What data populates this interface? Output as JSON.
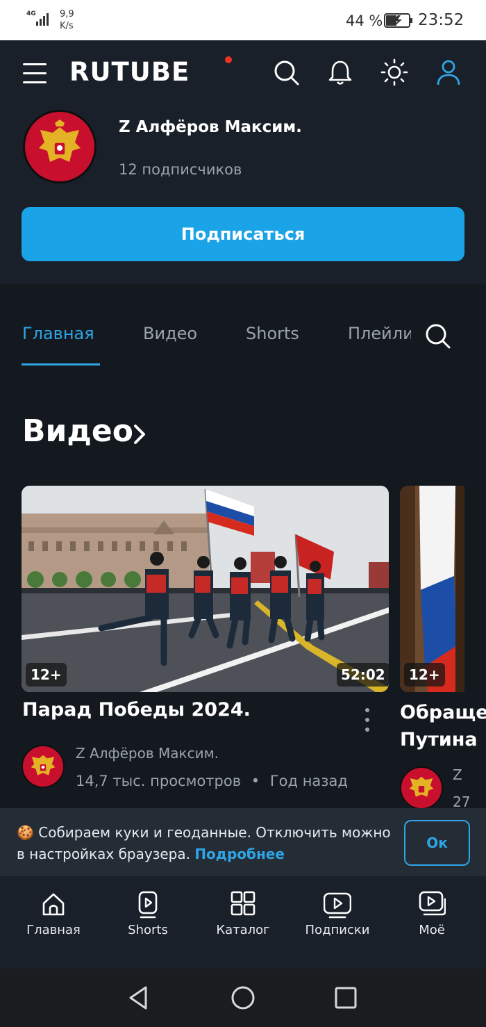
{
  "status_bar": {
    "network": "4G",
    "speed_value": "9,9",
    "speed_unit": "K/s",
    "battery_percent": "44 %",
    "time": "23:52"
  },
  "header": {
    "logo": "RUTUBE",
    "icons": [
      "menu-icon",
      "search-icon",
      "bell-icon",
      "theme-sun-icon",
      "user-icon"
    ]
  },
  "channel": {
    "name": "Z Алфёров Максим.",
    "subscribers": "12 подписчиков",
    "subscribe_label": "Подписаться"
  },
  "tabs": [
    {
      "label": "Главная",
      "active": true
    },
    {
      "label": "Видео",
      "active": false
    },
    {
      "label": "Shorts",
      "active": false
    },
    {
      "label": "Плейлисты",
      "active": false
    }
  ],
  "section": {
    "title": "Видео"
  },
  "videos": [
    {
      "title": "Парад Победы 2024.",
      "age_rating": "12+",
      "duration": "52:02",
      "author": "Z Алфёров Максим.",
      "views": "14,7 тыс. просмотров",
      "separator": "•",
      "date": "Год назад"
    },
    {
      "title": "Обращение Путина",
      "age_rating": "12+",
      "author": "Z",
      "meta": "27"
    }
  ],
  "cookie_banner": {
    "text": "🍪 Собираем куки и геоданные. Отключить можно в настройках браузера.",
    "link": "Подробнее",
    "ok_label": "Ок"
  },
  "bottom_nav": [
    {
      "label": "Главная",
      "icon": "home-icon"
    },
    {
      "label": "Shorts",
      "icon": "shorts-icon"
    },
    {
      "label": "Каталог",
      "icon": "catalog-icon"
    },
    {
      "label": "Подписки",
      "icon": "subscriptions-icon"
    },
    {
      "label": "Моё",
      "icon": "my-icon"
    }
  ],
  "colors": {
    "accent": "#1aa3e6",
    "background": "#14191f",
    "header_bg": "#1a2029",
    "logo_dot": "#ef3124"
  }
}
